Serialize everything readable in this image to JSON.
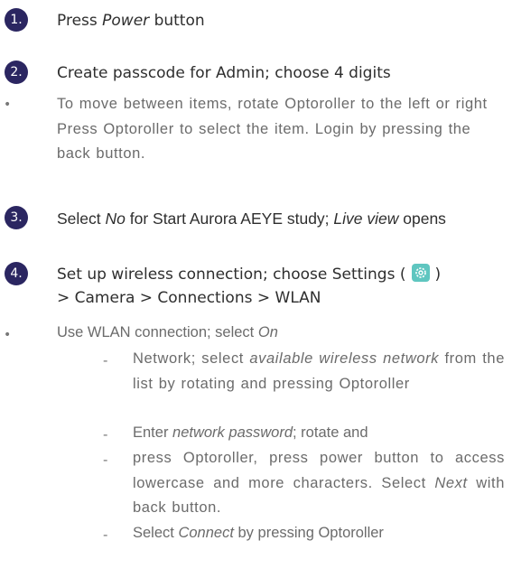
{
  "steps": [
    {
      "number": "1.",
      "text_a": "Press ",
      "em": "Power",
      "text_b": " button"
    },
    {
      "number": "2.",
      "text": "Create passcode for Admin; choose 4 digits",
      "bullet": "•",
      "detail": "To move between items, rotate Optoroller to the left or right Press Optoroller to select the item. Login by pressing the back button."
    },
    {
      "number": "3.",
      "text_a": "Select ",
      "em1": "No",
      "text_b": " for Start Aurora AEYE study; ",
      "em2": "Live view",
      "text_c": " opens"
    },
    {
      "number": "4.",
      "line1_a": "Set up wireless connection; choose Settings (",
      "line1_b": ")",
      "line2": "> Camera > Connections > WLAN",
      "bullet": "•",
      "wlan_a": "Use WLAN connection; select ",
      "wlan_em": "On",
      "dash": "-",
      "sub1_a": "Network; select ",
      "sub1_em": "available wireless network",
      "sub1_b": " from the list by rotating and pressing Optoroller",
      "sub2_a": "Enter ",
      "sub2_em": "network password",
      "sub2_b": "; rotate and",
      "sub3_a": "press Optoroller, press power button to access lowercase and more characters. Select ",
      "sub3_em": "Next",
      "sub3_b": " with back button.",
      "sub4_a": "Select ",
      "sub4_em": "Connect",
      "sub4_b": " by pressing Optoroller"
    }
  ],
  "icons": {
    "settings": "gear-icon"
  },
  "colors": {
    "badge": "#2b2661",
    "settings_icon_bg": "#5fc6c0"
  }
}
